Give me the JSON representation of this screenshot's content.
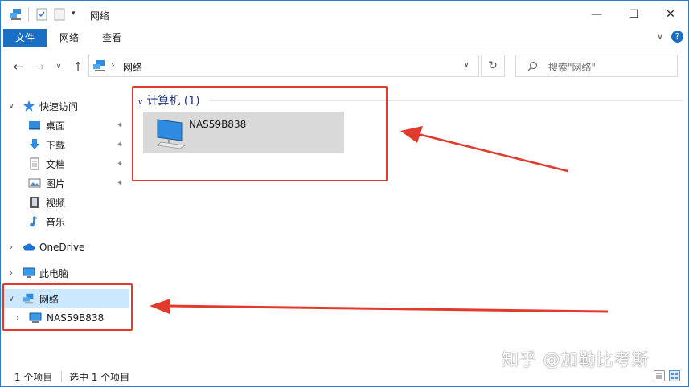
{
  "window": {
    "title": "网络",
    "controls": {
      "minimize": "—",
      "maximize": "☐",
      "close": "✕"
    }
  },
  "ribbon": {
    "tabs": [
      {
        "label": "文件",
        "active": true
      },
      {
        "label": "网络",
        "active": false
      },
      {
        "label": "查看",
        "active": false
      }
    ],
    "collapse_glyph": "∨",
    "help_glyph": "?"
  },
  "navigation": {
    "back_glyph": "←",
    "forward_glyph": "→",
    "recent_glyph": "∨",
    "up_glyph": "↑",
    "address_text": "网络",
    "address_separator": "›",
    "address_dropdown_glyph": "∨",
    "refresh_glyph": "↻",
    "search_placeholder": "搜索\"网络\""
  },
  "sidebar": {
    "items": [
      {
        "label": "快速访问",
        "icon": "star-icon"
      },
      {
        "label": "桌面",
        "icon": "desktop-icon",
        "pinned": true
      },
      {
        "label": "下载",
        "icon": "download-icon",
        "pinned": true
      },
      {
        "label": "文档",
        "icon": "document-icon",
        "pinned": true
      },
      {
        "label": "图片",
        "icon": "picture-icon",
        "pinned": true
      },
      {
        "label": "视频",
        "icon": "video-icon"
      },
      {
        "label": "音乐",
        "icon": "music-icon"
      },
      {
        "label": "OneDrive",
        "icon": "cloud-icon"
      },
      {
        "label": "此电脑",
        "icon": "computer-icon"
      },
      {
        "label": "网络",
        "icon": "network-icon",
        "selected": true
      },
      {
        "label": "NAS59B838",
        "icon": "computer-icon"
      }
    ],
    "pin_glyph": "📌"
  },
  "main": {
    "group_header": "计算机 (1)",
    "items": [
      {
        "label": "NAS59B838",
        "icon": "computer-icon"
      }
    ]
  },
  "status": {
    "count": "1 个项目",
    "selection": "选中 1 个项目"
  },
  "watermark": "知乎 @加勒比考斯",
  "colors": {
    "accent": "#1a6fc4",
    "selection": "#cce8ff",
    "annotation_red": "#e23a2d"
  }
}
